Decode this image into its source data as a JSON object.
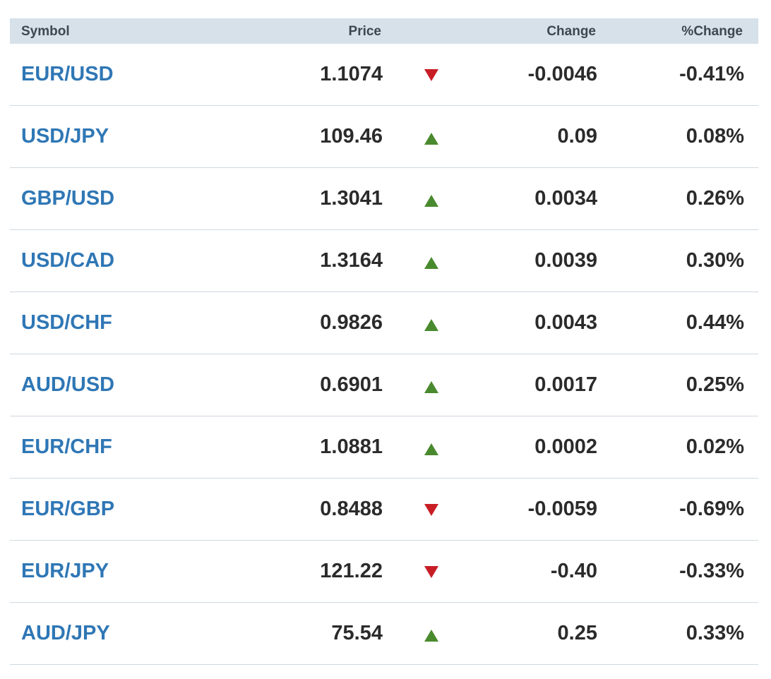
{
  "table": {
    "headers": {
      "symbol": "Symbol",
      "price": "Price",
      "change": "Change",
      "pct_change": "%Change"
    },
    "rows": [
      {
        "symbol": "EUR/USD",
        "price": "1.1074",
        "direction": "down",
        "change": "-0.0046",
        "pct_change": "-0.41%"
      },
      {
        "symbol": "USD/JPY",
        "price": "109.46",
        "direction": "up",
        "change": "0.09",
        "pct_change": "0.08%"
      },
      {
        "symbol": "GBP/USD",
        "price": "1.3041",
        "direction": "up",
        "change": "0.0034",
        "pct_change": "0.26%"
      },
      {
        "symbol": "USD/CAD",
        "price": "1.3164",
        "direction": "up",
        "change": "0.0039",
        "pct_change": "0.30%"
      },
      {
        "symbol": "USD/CHF",
        "price": "0.9826",
        "direction": "up",
        "change": "0.0043",
        "pct_change": "0.44%"
      },
      {
        "symbol": "AUD/USD",
        "price": "0.6901",
        "direction": "up",
        "change": "0.0017",
        "pct_change": "0.25%"
      },
      {
        "symbol": "EUR/CHF",
        "price": "1.0881",
        "direction": "up",
        "change": "0.0002",
        "pct_change": "0.02%"
      },
      {
        "symbol": "EUR/GBP",
        "price": "0.8488",
        "direction": "down",
        "change": "-0.0059",
        "pct_change": "-0.69%"
      },
      {
        "symbol": "EUR/JPY",
        "price": "121.22",
        "direction": "down",
        "change": "-0.40",
        "pct_change": "-0.33%"
      },
      {
        "symbol": "AUD/JPY",
        "price": "75.54",
        "direction": "up",
        "change": "0.25",
        "pct_change": "0.33%"
      }
    ]
  },
  "colors": {
    "symbol_link": "#2f77b5",
    "up_arrow": "#4a8a2e",
    "down_arrow": "#c81d25",
    "header_bg": "#d6e1ea",
    "row_divider": "#cfd8df"
  },
  "icons": {
    "up": "triangle-up-icon",
    "down": "triangle-down-icon"
  }
}
